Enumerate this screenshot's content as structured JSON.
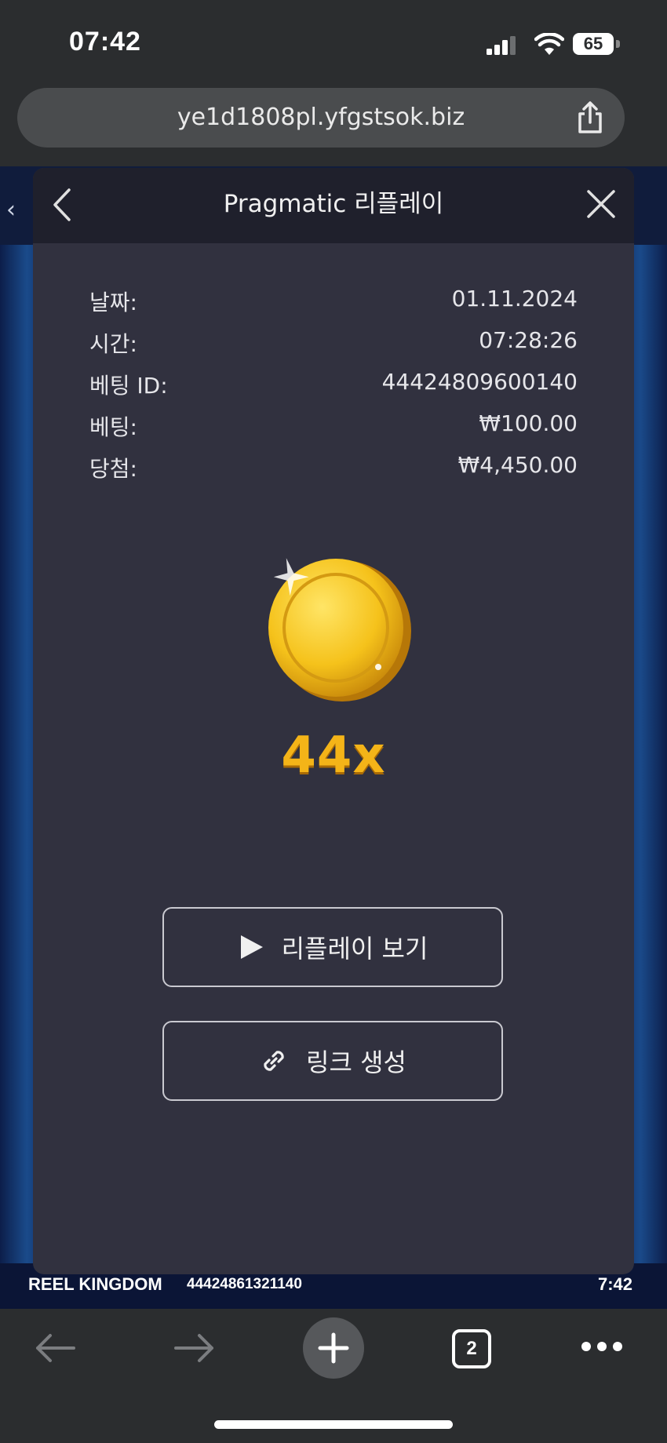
{
  "status_bar": {
    "time": "07:42",
    "battery": "65"
  },
  "browser": {
    "url": "ye1d1808pl.yfgstsok.biz",
    "tab_count": "2"
  },
  "game": {
    "left_arrow": "‹",
    "provider": "REEL KINGDOM",
    "round_id": "44424861321140",
    "clock": "7:42"
  },
  "modal": {
    "title": "Pragmatic 리플레이",
    "rows": [
      {
        "label": "날짜:",
        "value": "01.11.2024"
      },
      {
        "label": "시간:",
        "value": "07:28:26"
      },
      {
        "label": "베팅 ID:",
        "value": "44424809600140"
      },
      {
        "label": "베팅:",
        "value": "₩100.00"
      },
      {
        "label": "당첨:",
        "value": "₩4,450.00"
      }
    ],
    "multiplier": "44x",
    "replay_button": "리플레이 보기",
    "link_button": "링크 생성"
  },
  "colors": {
    "modal_bg": "#31313f",
    "header_bg": "#1f202c",
    "multiplier": "#f4b418",
    "coin": "#f5c21b"
  },
  "icons": [
    "signal-icon",
    "wifi-icon",
    "share-icon",
    "back-icon",
    "close-icon",
    "coin-icon",
    "play-icon",
    "link-icon",
    "arrow-left-icon",
    "arrow-right-icon",
    "plus-icon",
    "more-icon"
  ]
}
